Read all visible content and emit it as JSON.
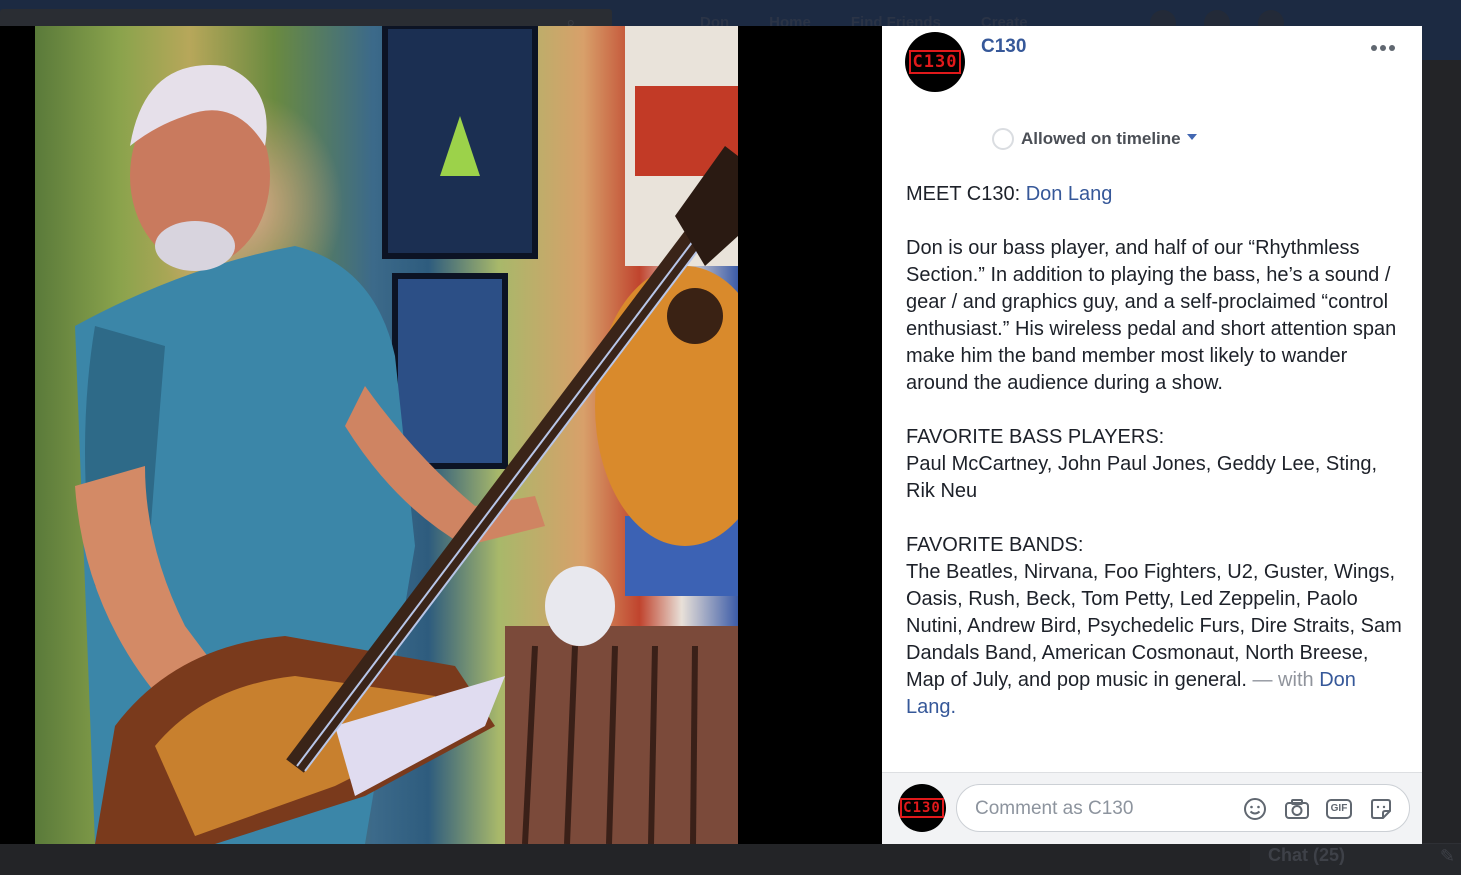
{
  "background": {
    "nav_items": [
      "Don",
      "Home",
      "Find Friends",
      "Create"
    ],
    "chat_label": "Chat (25)"
  },
  "post": {
    "page_name": "C130",
    "avatar_text": "C130",
    "timeline_status": "Allowed on timeline",
    "intro_prefix": "MEET C130: ",
    "intro_link": "Don Lang",
    "bio": "Don is our bass player, and half of our “Rhythmless Section.” In addition to playing the bass, he’s a sound / gear / and graphics guy, and a self-proclaimed “control enthusiast.” His wireless pedal and short attention span make him the band member most likely to wander around the audience during a show.",
    "bass_heading": "FAVORITE BASS PLAYERS:",
    "bass_players": "Paul McCartney, John Paul Jones, Geddy Lee, Sting, Rik Neu",
    "bands_heading": "FAVORITE BANDS:",
    "bands": "The Beatles, Nirvana, Foo Fighters, U2, Guster, Wings, Oasis, Rush, Beck, Tom Petty, Led Zeppelin, Paolo Nutini, Andrew Bird, Psychedelic Furs, Dire Straits, Sam Dandals Band, American Cosmonaut, North Breese, Map of July, and pop music in general.",
    "with_label": " — with ",
    "with_link": "Don Lang."
  },
  "comment": {
    "placeholder": "Comment as C130",
    "gif_label": "GIF"
  },
  "icons": {
    "more": "more-options-icon",
    "emoji": "emoji-icon",
    "camera": "camera-icon",
    "gif": "gif-icon",
    "sticker": "sticker-icon"
  },
  "colors": {
    "link": "#365899",
    "text": "#1d2129",
    "brand_red": "#e0191b"
  }
}
